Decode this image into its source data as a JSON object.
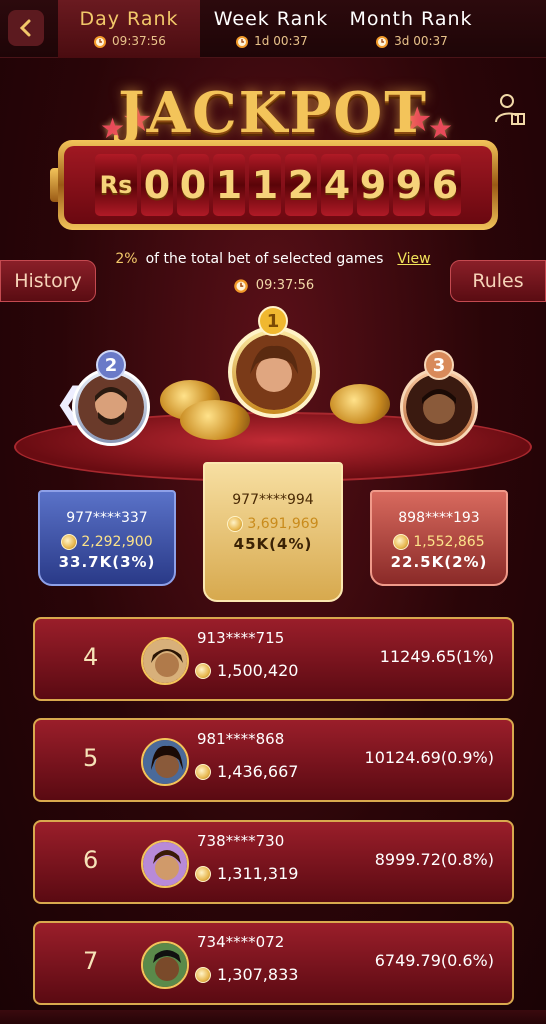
{
  "tabs": [
    {
      "label": "Day Rank",
      "time": "09:37:56",
      "active": true
    },
    {
      "label": "Week Rank",
      "time": "1d 00:37",
      "active": false
    },
    {
      "label": "Month Rank",
      "time": "3d 00:37",
      "active": false
    }
  ],
  "jackpot": {
    "title": "JACKPOT",
    "currency": "Rs",
    "digits": [
      "0",
      "0",
      "1",
      "1",
      "2",
      "4",
      "9",
      "9",
      "6"
    ],
    "percent": "2%",
    "description": "of the total bet of selected games",
    "view_label": "View",
    "timer": "09:37:56"
  },
  "buttons": {
    "history": "History",
    "rules": "Rules"
  },
  "podium": {
    "second": {
      "rank": "2",
      "id": "977****337",
      "coins": "2,292,900",
      "prize": "33.7K(3%)"
    },
    "first": {
      "rank": "1",
      "id": "977****994",
      "coins": "3,691,969",
      "prize": "45K(4%)"
    },
    "third": {
      "rank": "3",
      "id": "898****193",
      "coins": "1,552,865",
      "prize": "22.5K(2%)"
    }
  },
  "ranks": [
    {
      "rank": "4",
      "id": "913****715",
      "coins": "1,500,420",
      "prize": "11249.65(1%)"
    },
    {
      "rank": "5",
      "id": "981****868",
      "coins": "1,436,667",
      "prize": "10124.69(0.9%)"
    },
    {
      "rank": "6",
      "id": "738****730",
      "coins": "1,311,319",
      "prize": "8999.72(0.8%)"
    },
    {
      "rank": "7",
      "id": "734****072",
      "coins": "1,307,833",
      "prize": "6749.79(0.6%)"
    }
  ],
  "icons": {
    "back": "chevron-left-icon",
    "clock": "alarm-clock-icon",
    "profile_gift": "user-gift-icon",
    "coin": "coin-icon"
  },
  "colors": {
    "gold": "#f3c45a",
    "maroon": "#5a0a12",
    "accent_red": "#9a1e2a"
  }
}
